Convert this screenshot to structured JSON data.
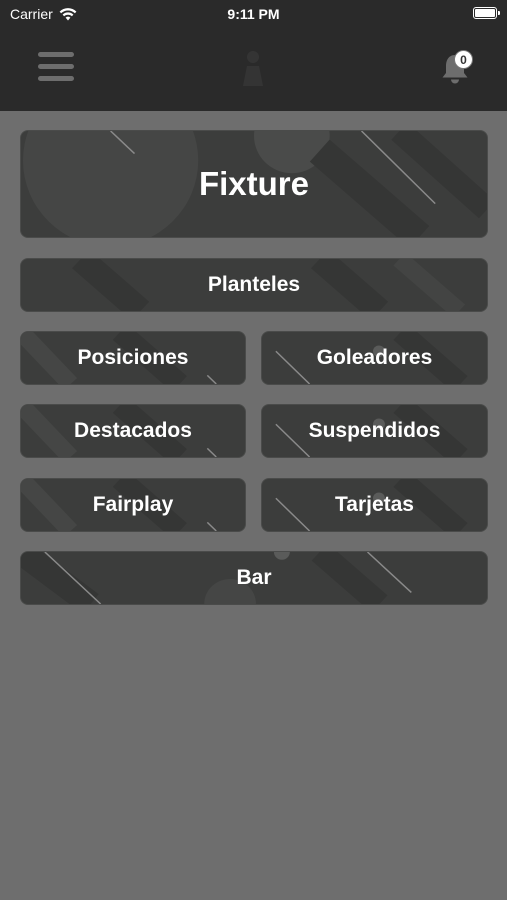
{
  "status_bar": {
    "carrier": "Carrier",
    "time": "9:11 PM"
  },
  "header": {
    "menu_icon": "hamburger-menu-icon",
    "logo_icon": "app-logo-icon",
    "notification_icon": "bell-icon",
    "notification_count": "0"
  },
  "colors": {
    "nav_background": "#2a2a2a",
    "page_background": "#6e6e6e",
    "card_background": "#3c3d3c",
    "card_text": "#ffffff"
  },
  "menu": {
    "fixture": "Fixture",
    "planteles": "Planteles",
    "posiciones": "Posiciones",
    "goleadores": "Goleadores",
    "destacados": "Destacados",
    "suspendidos": "Suspendidos",
    "fairplay": "Fairplay",
    "tarjetas": "Tarjetas",
    "bar": "Bar"
  }
}
